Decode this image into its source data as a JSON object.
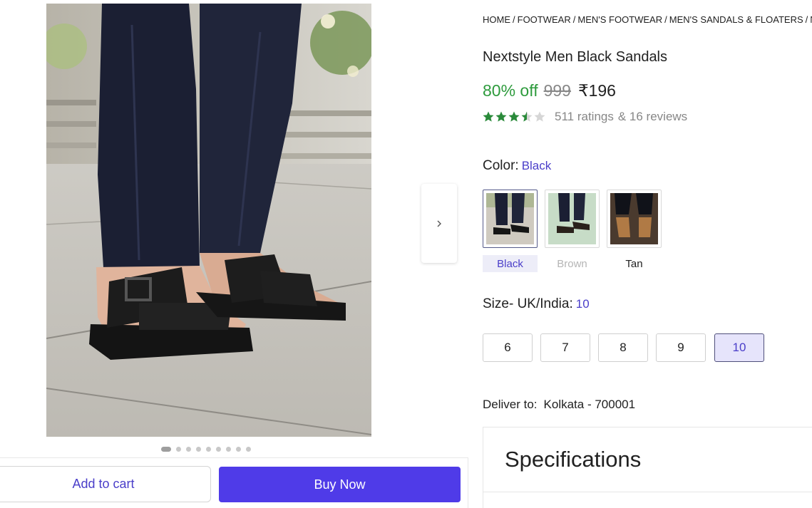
{
  "breadcrumb": [
    "HOME",
    "FOOTWEAR",
    "MEN'S FOOTWEAR",
    "MEN'S SANDALS & FLOATERS",
    "NE"
  ],
  "product": {
    "title": "Nextstyle Men Black Sandals",
    "discount": "80% off",
    "mrp": "999",
    "price": "₹196",
    "rating_value": 3.5,
    "ratings_text": "511 ratings",
    "reviews_text": "& 16 reviews"
  },
  "color": {
    "label": "Color:",
    "selected": "Black",
    "options": [
      {
        "label": "Black",
        "state": "selected"
      },
      {
        "label": "Brown",
        "state": "disabled"
      },
      {
        "label": "Tan",
        "state": "available"
      }
    ]
  },
  "size": {
    "label": "Size- UK/India:",
    "selected": "10",
    "options": [
      "6",
      "7",
      "8",
      "9",
      "10"
    ]
  },
  "delivery": {
    "label": "Deliver to:",
    "location": "Kolkata - 700001"
  },
  "specifications": {
    "title": "Specifications"
  },
  "gallery": {
    "image_count": 9,
    "active_index": 0
  },
  "actions": {
    "add_to_cart": "Add to cart",
    "buy_now": "Buy Now"
  },
  "colors": {
    "accent": "#4f3be8",
    "accent_text": "#4a3ec9",
    "discount_green": "#2e9b3d",
    "star_green": "#2a8a3a",
    "muted": "#878787"
  },
  "icons": {
    "next": "chevron-right-icon",
    "star": "star-icon"
  }
}
